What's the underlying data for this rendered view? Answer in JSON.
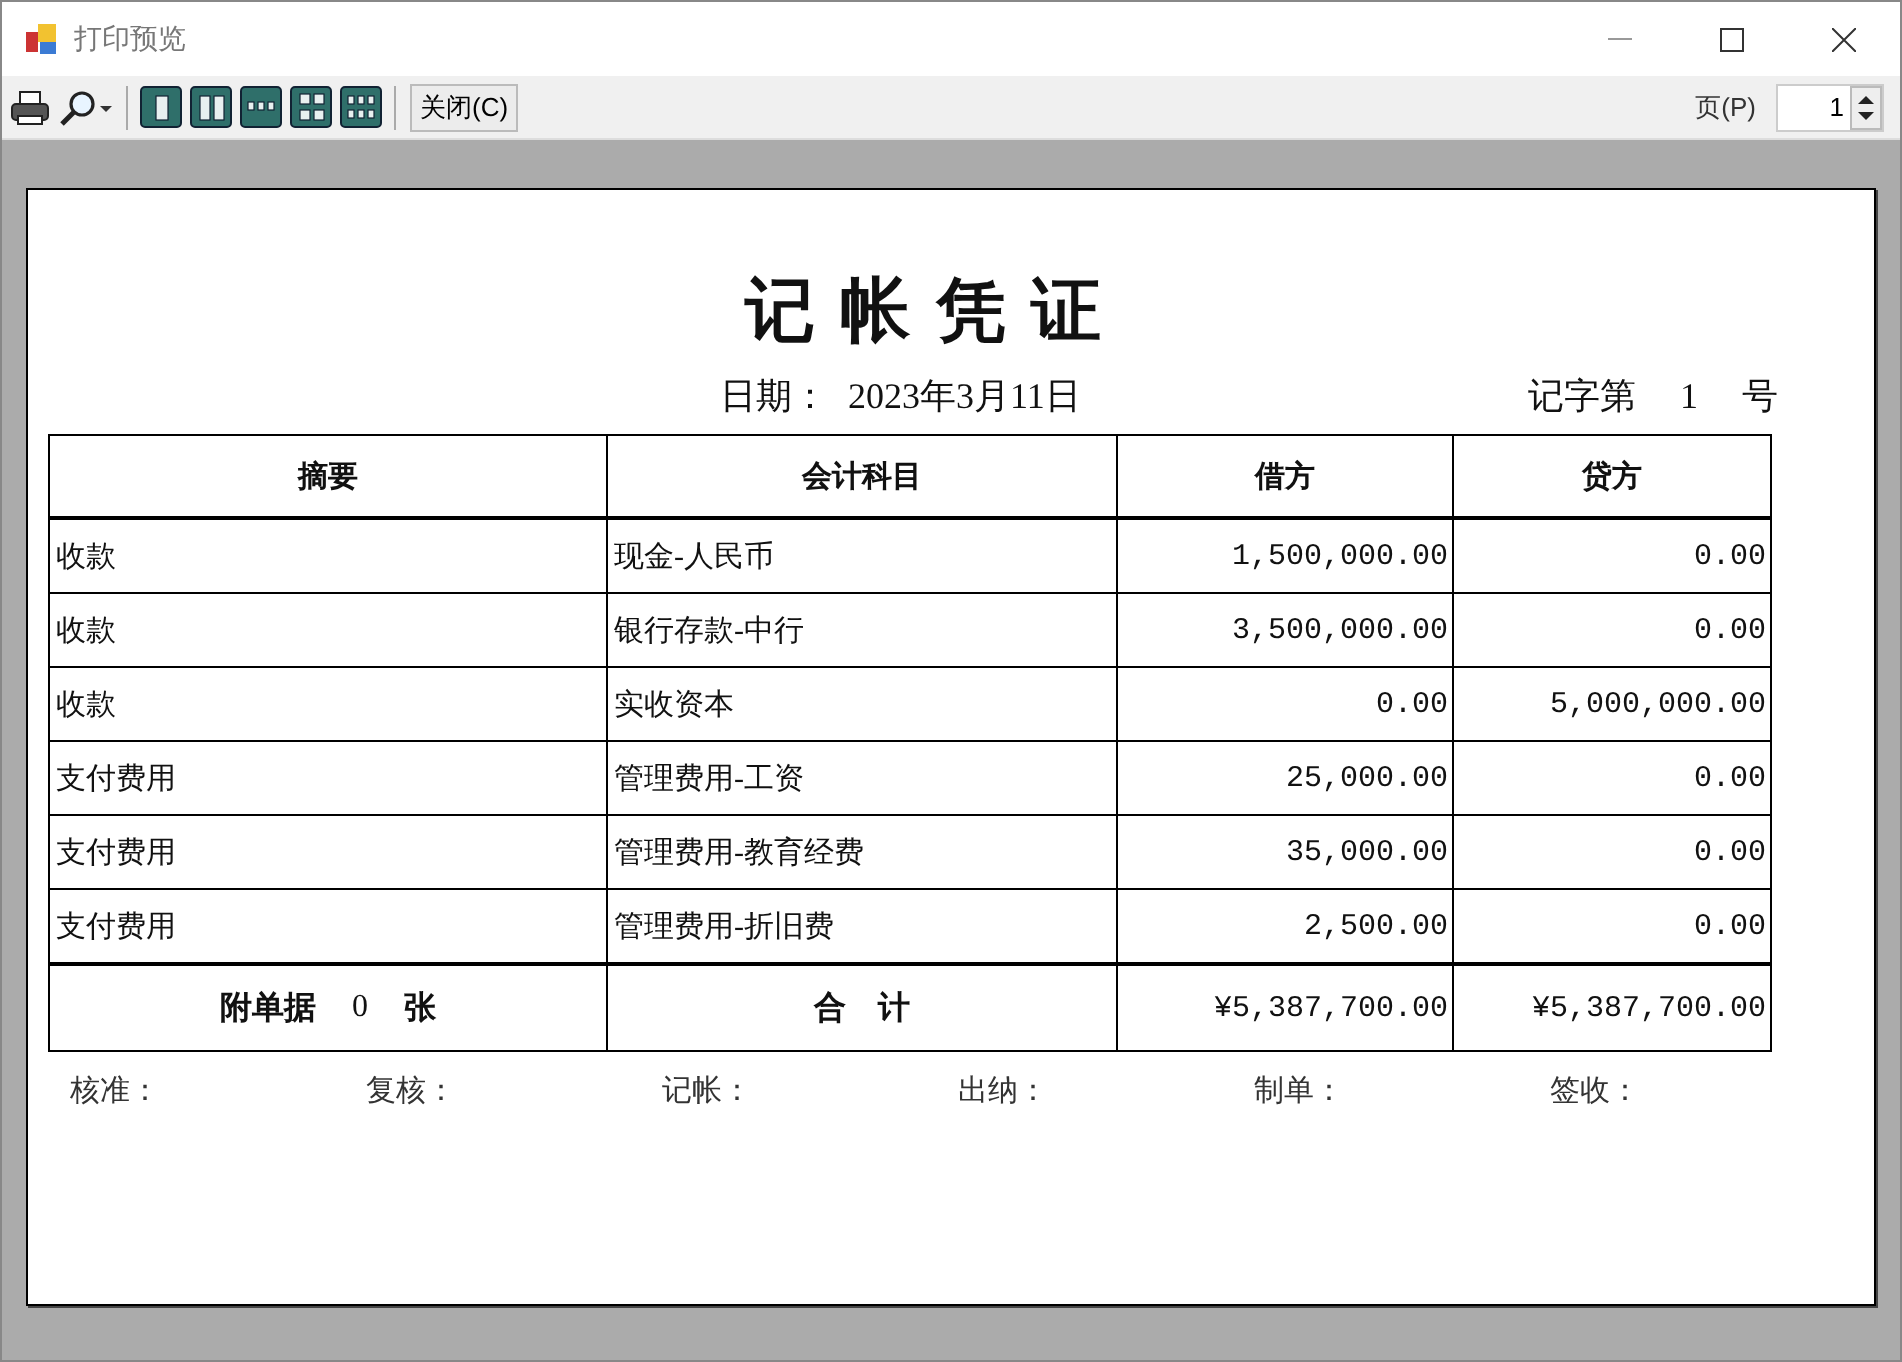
{
  "window": {
    "title": "打印预览"
  },
  "toolbar": {
    "tools": [
      {
        "kind": "print"
      },
      {
        "kind": "zoom"
      },
      {
        "kind": "one"
      },
      {
        "kind": "two"
      },
      {
        "kind": "three"
      },
      {
        "kind": "four"
      },
      {
        "kind": "six"
      }
    ],
    "close_button": "关闭(C)",
    "page_label": "页(P)",
    "page_value": "1"
  },
  "voucher": {
    "title": "记 帐 凭 证",
    "date_label": "日期：",
    "date": "2023年3月11日",
    "number_prefix": "记字第",
    "number": "1",
    "number_suffix": "号",
    "columns": [
      "摘要",
      "会计科目",
      "借方",
      "贷方"
    ],
    "rows": [
      [
        "收款",
        "现金-人民币",
        "1,500,000.00",
        "0.00"
      ],
      [
        "收款",
        "银行存款-中行",
        "3,500,000.00",
        "0.00"
      ],
      [
        "收款",
        "实收资本",
        "0.00",
        "5,000,000.00"
      ],
      [
        "支付费用",
        "管理费用-工资",
        "25,000.00",
        "0.00"
      ],
      [
        "支付费用",
        "管理费用-教育经费",
        "35,000.00",
        "0.00"
      ],
      [
        "支付费用",
        "管理费用-折旧费",
        "2,500.00",
        "0.00"
      ]
    ],
    "attachments_label": "附单据",
    "attachments_count": "0",
    "attachments_unit": "张",
    "total_label": "合　计",
    "total_debit": "¥5,387,700.00",
    "total_credit": "¥5,387,700.00",
    "signatures": [
      "核准：",
      "复核：",
      "记帐：",
      "出纳：",
      "制单：",
      "签收："
    ]
  }
}
